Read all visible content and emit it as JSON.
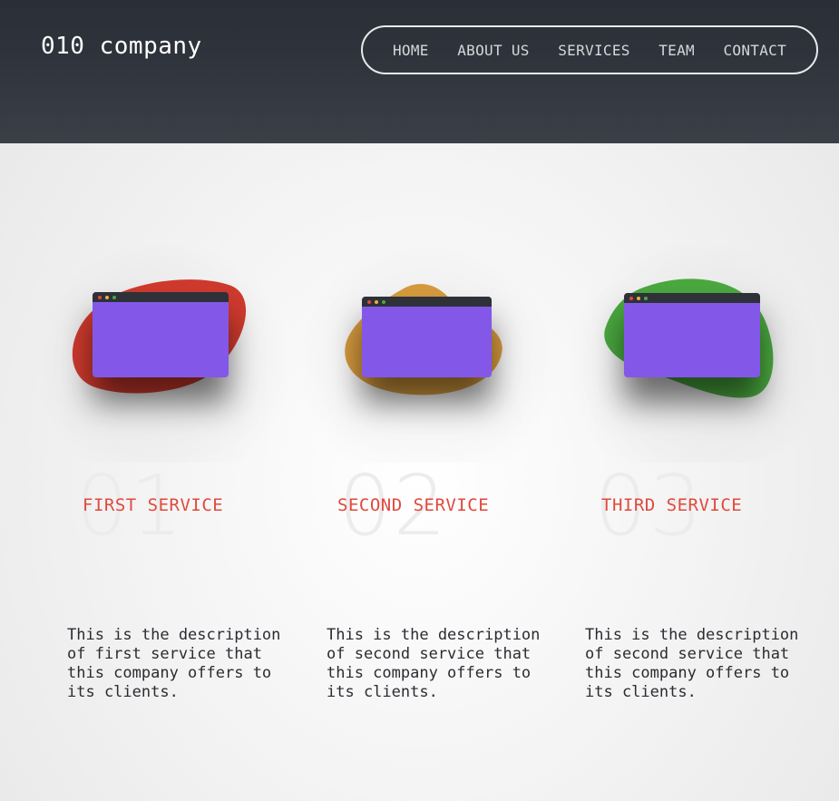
{
  "header": {
    "logo": "010 company",
    "nav": [
      "HOME",
      "ABOUT US",
      "SERVICES",
      "TEAM",
      "CONTACT"
    ]
  },
  "services": [
    {
      "number": "01",
      "title": "FIRST SERVICE",
      "description": "This is the description of first service that this company offers to its clients.",
      "blob_color": "#cf3a2e"
    },
    {
      "number": "02",
      "title": "SECOND SERVICE",
      "description": "This is the description of second service that this company offers to its clients.",
      "blob_color": "#d59a3e"
    },
    {
      "number": "03",
      "title": "THIRD SERVICE",
      "description": "This is the description of second service that this company offers to its clients.",
      "blob_color": "#4aa83f"
    }
  ],
  "colors": {
    "accent": "#e0493d",
    "window": "#8358e8",
    "header_bg": "#2f333c"
  }
}
